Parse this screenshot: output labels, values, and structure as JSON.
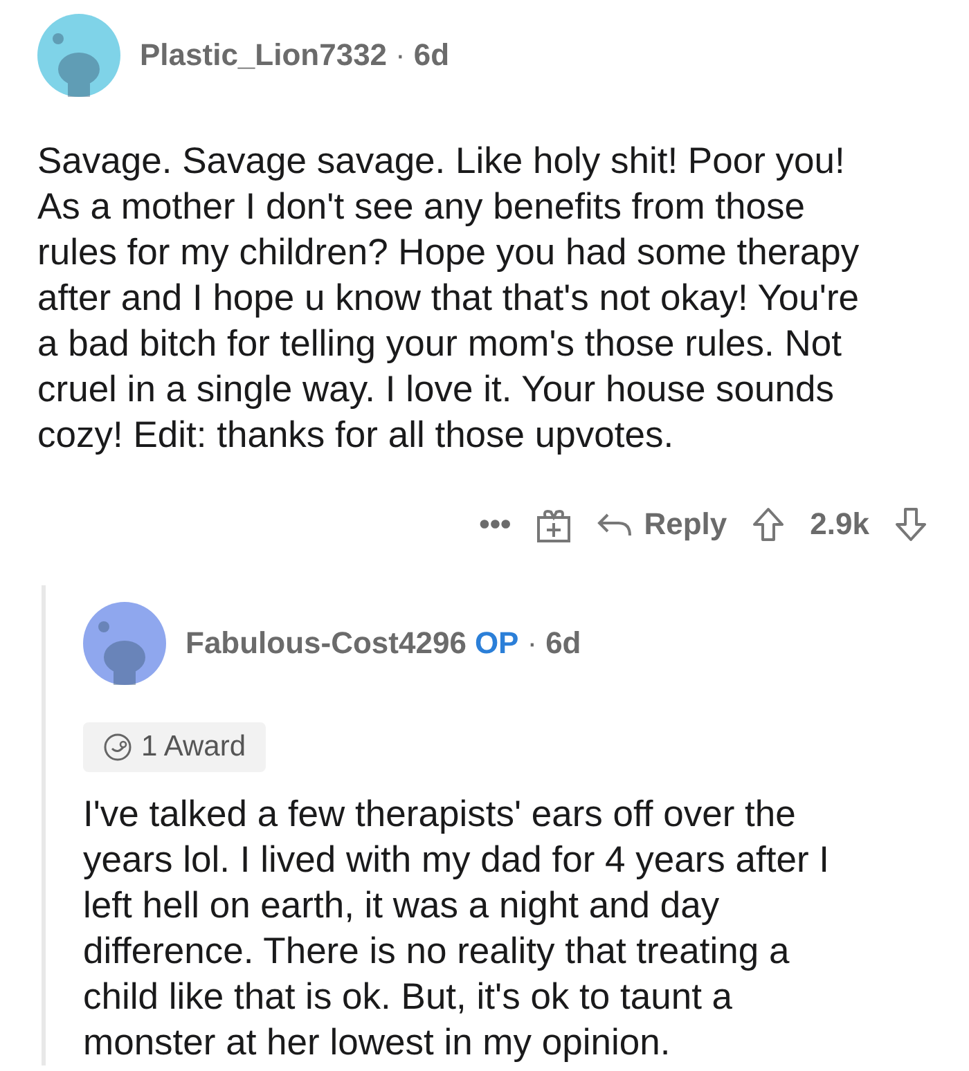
{
  "comments": [
    {
      "author": "Plastic_Lion7332",
      "separator": "·",
      "time": "6d",
      "color": "#7fd3e8",
      "nested": false,
      "body": "Savage. Savage savage. Like holy shit! Poor you! As a mother I don't see any benefits from those rules for my children? Hope you had some therapy after and I hope u know that that's not okay! You're a bad bitch for telling your mom's those rules. Not cruel in a single way. I love it. Your house sounds cozy! Edit: thanks for all those upvotes.",
      "actions": {
        "more": "•••",
        "reply": "Reply",
        "score": "2.9k"
      }
    },
    {
      "author": "Fabulous-Cost4296",
      "op_badge": "OP",
      "separator": "·",
      "time": "6d",
      "color": "#8fa7ee",
      "nested": true,
      "award": "1 Award",
      "body": "I've talked a few therapists' ears off over the years lol. I lived with my dad for 4 years after I left hell on earth, it was a night and day difference. There is no reality that treating a child like that is ok. But, it's ok to taunt a monster at her lowest in my opinion."
    }
  ]
}
